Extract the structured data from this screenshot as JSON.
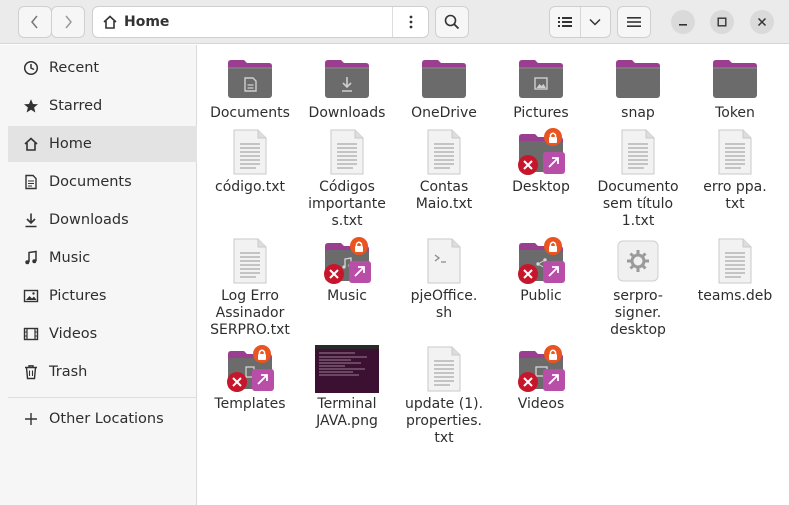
{
  "pathbar": {
    "crumb": "Home"
  },
  "colors": {
    "folder_body": "#6b6b6b",
    "folder_tab": "#9a3f8f",
    "lock": "#e95420",
    "emblem_x": "#c7162b",
    "emblem_bg": "#b84ea8"
  },
  "sidebar": {
    "items": [
      {
        "label": "Recent",
        "icon": "clock-icon"
      },
      {
        "label": "Starred",
        "icon": "star-icon"
      },
      {
        "label": "Home",
        "icon": "home-icon"
      },
      {
        "label": "Documents",
        "icon": "document-icon"
      },
      {
        "label": "Downloads",
        "icon": "download-icon"
      },
      {
        "label": "Music",
        "icon": "music-icon"
      },
      {
        "label": "Pictures",
        "icon": "picture-icon"
      },
      {
        "label": "Videos",
        "icon": "video-icon"
      },
      {
        "label": "Trash",
        "icon": "trash-icon"
      },
      {
        "label": "Other Locations",
        "icon": "plus-icon"
      }
    ]
  },
  "files": [
    {
      "label": "Documents",
      "kind": "folder",
      "glyph": "doc"
    },
    {
      "label": "Downloads",
      "kind": "folder",
      "glyph": "down"
    },
    {
      "label": "OneDrive",
      "kind": "folder",
      "glyph": ""
    },
    {
      "label": "Pictures",
      "kind": "folder",
      "glyph": "pic"
    },
    {
      "label": "snap",
      "kind": "folder",
      "glyph": ""
    },
    {
      "label": "Token",
      "kind": "folder",
      "glyph": ""
    },
    {
      "label": "código.txt",
      "kind": "text"
    },
    {
      "label": "Códigos\nimportante\ns.txt",
      "kind": "text"
    },
    {
      "label": "Contas\nMaio.txt",
      "kind": "text"
    },
    {
      "label": "Desktop",
      "kind": "locked",
      "glyph": ""
    },
    {
      "label": "Documento\nsem título\n1.txt",
      "kind": "text"
    },
    {
      "label": "erro ppa.\ntxt",
      "kind": "text"
    },
    {
      "label": "Log Erro\nAssinador\nSERPRO.txt",
      "kind": "text"
    },
    {
      "label": "Music",
      "kind": "locked",
      "glyph": "music"
    },
    {
      "label": "pjeOffice.\nsh",
      "kind": "script"
    },
    {
      "label": "Public",
      "kind": "locked",
      "glyph": "share"
    },
    {
      "label": "serpro-\nsigner.\ndesktop",
      "kind": "desktop"
    },
    {
      "label": "teams.deb",
      "kind": "text"
    },
    {
      "label": "Templates",
      "kind": "locked",
      "glyph": "tmpl"
    },
    {
      "label": "Terminal\nJAVA.png",
      "kind": "image"
    },
    {
      "label": "update (1).\nproperties.\ntxt",
      "kind": "text"
    },
    {
      "label": "Videos",
      "kind": "locked",
      "glyph": "video"
    }
  ]
}
